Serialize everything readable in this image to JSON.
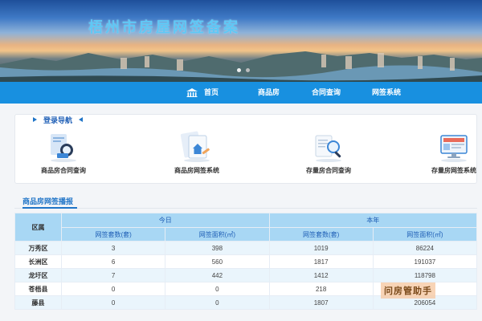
{
  "banner": {
    "title": "梧州市房屋网签备案",
    "carousel_active_index": 1,
    "carousel_count": 2
  },
  "nav": {
    "items": [
      {
        "label": "首页",
        "icon": "home-icon"
      },
      {
        "label": "商品房"
      },
      {
        "label": "合同查询"
      },
      {
        "label": "网签系统"
      }
    ]
  },
  "login_nav": {
    "title": "登录导航",
    "services": [
      {
        "label": "商品房合同查询",
        "icon": "contract-search-icon"
      },
      {
        "label": "商品房网签系统",
        "icon": "house-contract-icon"
      },
      {
        "label": "存量房合同查询",
        "icon": "document-magnifier-icon"
      },
      {
        "label": "存量房网签系统",
        "icon": "monitor-icon"
      }
    ]
  },
  "report": {
    "title": "商品房网签播报",
    "headers": {
      "district": "区属",
      "today": "今日",
      "this_year": "本年",
      "count": "网签套数(套)",
      "area": "网签面积(㎡)"
    },
    "rows": [
      {
        "district": "万秀区",
        "today_count": "3",
        "today_area": "398",
        "year_count": "1019",
        "year_area": "86224"
      },
      {
        "district": "长洲区",
        "today_count": "6",
        "today_area": "560",
        "year_count": "1817",
        "year_area": "191037"
      },
      {
        "district": "龙圩区",
        "today_count": "7",
        "today_area": "442",
        "year_count": "1412",
        "year_area": "118798"
      },
      {
        "district": "苍梧县",
        "today_count": "0",
        "today_area": "0",
        "year_count": "218",
        "year_area": ""
      },
      {
        "district": "藤县",
        "today_count": "0",
        "today_area": "0",
        "year_count": "1807",
        "year_area": "206054"
      }
    ]
  },
  "watermark": "问房管助手",
  "colors": {
    "nav_blue": "#1890e0",
    "header_blue": "#a8d7f4",
    "accent": "#1f74c7"
  }
}
